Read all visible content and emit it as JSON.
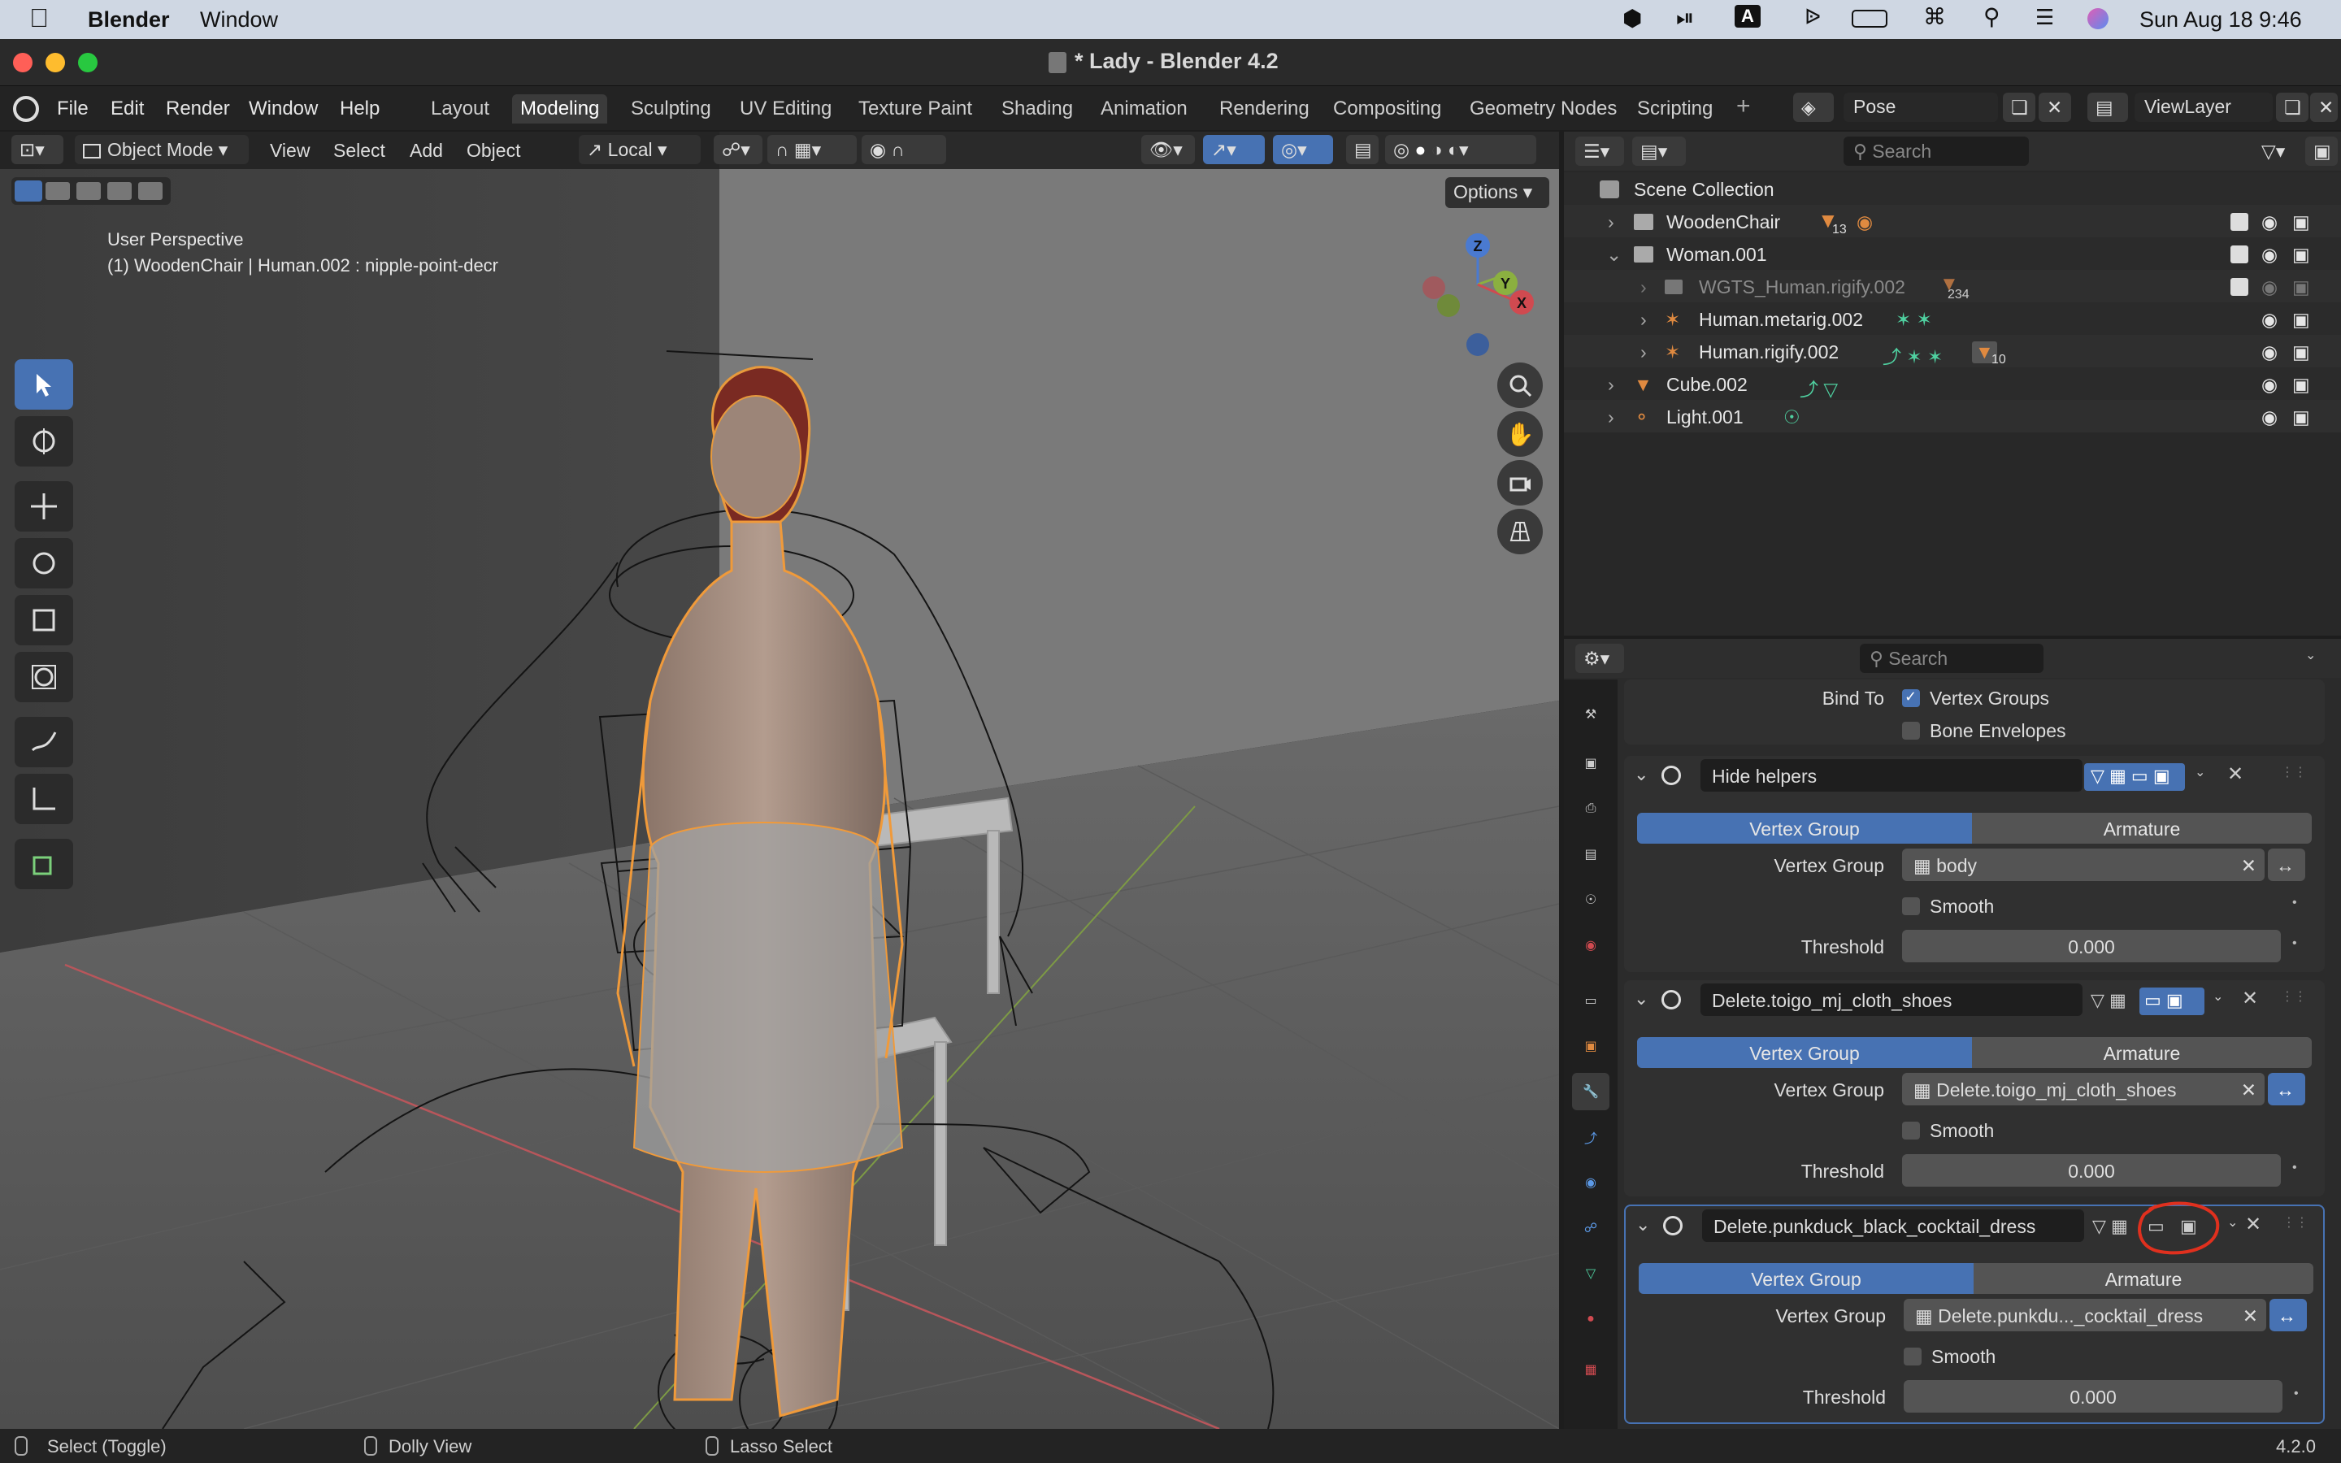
{
  "menubar": {
    "app": "Blender",
    "items": [
      "Window"
    ],
    "clock": "Sun Aug 18  9:46",
    "input_source": "A"
  },
  "window": {
    "title": "* Lady - Blender 4.2"
  },
  "app_menu": [
    "File",
    "Edit",
    "Render",
    "Window",
    "Help"
  ],
  "workspaces": [
    "Layout",
    "Modeling",
    "Sculpting",
    "UV Editing",
    "Texture Paint",
    "Shading",
    "Animation",
    "Rendering",
    "Compositing",
    "Geometry Nodes",
    "Scripting"
  ],
  "active_workspace": "Modeling",
  "scene_selector": {
    "pose": "Pose",
    "view_layer": "ViewLayer"
  },
  "viewport_header": {
    "mode": "Object Mode",
    "menus": [
      "View",
      "Select",
      "Add",
      "Object"
    ],
    "transform_orientation": "Local",
    "options": "Options"
  },
  "viewport": {
    "perspective": "User Perspective",
    "info": "(1) WoodenChair | Human.002 : nipple-point-decr",
    "gizmo": {
      "z": "Z",
      "y": "Y",
      "x": "X"
    }
  },
  "outliner": {
    "search_placeholder": "Search",
    "root": "Scene Collection",
    "rows": [
      {
        "label": "WoodenChair",
        "badge": "13"
      },
      {
        "label": "Woman.001"
      },
      {
        "label": "WGTS_Human.rigify.002",
        "badge": "234"
      },
      {
        "label": "Human.metarig.002"
      },
      {
        "label": "Human.rigify.002",
        "badge": "10"
      },
      {
        "label": "Cube.002"
      },
      {
        "label": "Light.001"
      }
    ]
  },
  "properties": {
    "search_placeholder": "Search",
    "bind_to": {
      "label": "Bind To",
      "opt1": "Vertex Groups",
      "opt2": "Bone Envelopes"
    },
    "modifiers": [
      {
        "name": "Hide helpers",
        "tab_a": "Vertex Group",
        "tab_b": "Armature",
        "vg_label": "Vertex Group",
        "vg_value": "body",
        "smooth": "Smooth",
        "threshold_label": "Threshold",
        "threshold_value": "0.000"
      },
      {
        "name": "Delete.toigo_mj_cloth_shoes",
        "tab_a": "Vertex Group",
        "tab_b": "Armature",
        "vg_label": "Vertex Group",
        "vg_value": "Delete.toigo_mj_cloth_shoes",
        "smooth": "Smooth",
        "threshold_label": "Threshold",
        "threshold_value": "0.000"
      },
      {
        "name": "Delete.punkduck_black_cocktail_dress",
        "tab_a": "Vertex Group",
        "tab_b": "Armature",
        "vg_label": "Vertex Group",
        "vg_value": "Delete.punkdu..._cocktail_dress",
        "smooth": "Smooth",
        "threshold_label": "Threshold",
        "threshold_value": "0.000"
      }
    ]
  },
  "statusbar": {
    "left": "Select (Toggle)",
    "mid": "Dolly View",
    "right": "Lasso Select",
    "version": "4.2.0"
  }
}
